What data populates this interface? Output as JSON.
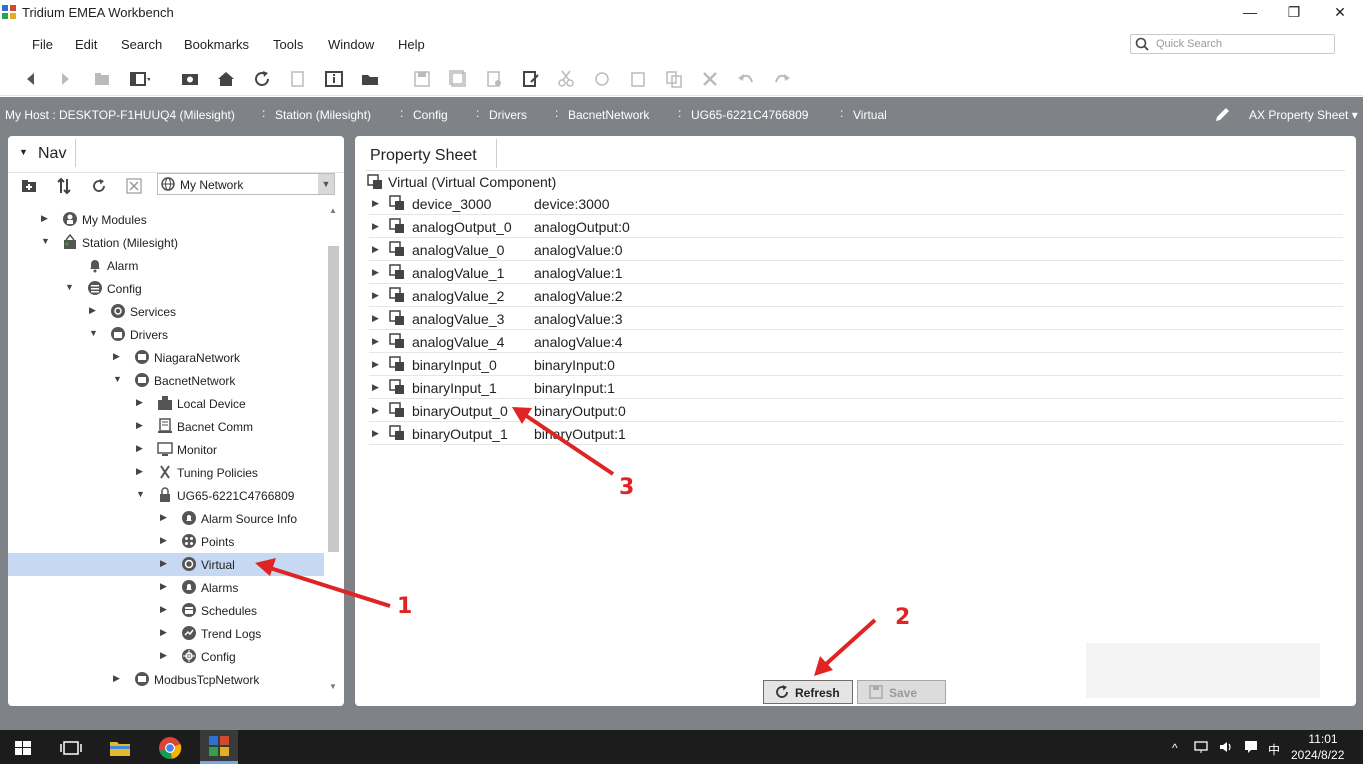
{
  "window": {
    "title": "Tridium EMEA Workbench",
    "minimize": "—",
    "restore": "❐",
    "close": "✕"
  },
  "menu": [
    "File",
    "Edit",
    "Search",
    "Bookmarks",
    "Tools",
    "Window",
    "Help"
  ],
  "quick_search": {
    "placeholder": "Quick Search"
  },
  "path": {
    "host": "My Host : DESKTOP-F1HUUQ4 (Milesight)",
    "crumbs": [
      "Station (Milesight)",
      "Config",
      "Drivers",
      "BacnetNetwork",
      "UG65-6221C4766809",
      "Virtual"
    ],
    "view_selector": "AX Property Sheet ▾"
  },
  "nav": {
    "tab_label": "Nav",
    "network_select": "My Network",
    "tree": [
      {
        "label": "My Modules",
        "expander": "▶",
        "icon": "modules-icon"
      },
      {
        "label": "Station (Milesight)",
        "expander": "▼",
        "icon": "station-icon"
      },
      {
        "label": "Alarm",
        "expander": "",
        "icon": "bell-icon"
      },
      {
        "label": "Config",
        "expander": "▼",
        "icon": "config-icon"
      },
      {
        "label": "Services",
        "expander": "▶",
        "icon": "services-icon"
      },
      {
        "label": "Drivers",
        "expander": "▼",
        "icon": "drivers-icon"
      },
      {
        "label": "NiagaraNetwork",
        "expander": "▶",
        "icon": "network-icon"
      },
      {
        "label": "BacnetNetwork",
        "expander": "▼",
        "icon": "network-icon"
      },
      {
        "label": "Local Device",
        "expander": "▶",
        "icon": "local-device-icon"
      },
      {
        "label": "Bacnet Comm",
        "expander": "▶",
        "icon": "comm-icon"
      },
      {
        "label": "Monitor",
        "expander": "▶",
        "icon": "monitor-icon"
      },
      {
        "label": "Tuning Policies",
        "expander": "▶",
        "icon": "tuning-icon"
      },
      {
        "label": "UG65-6221C4766809",
        "expander": "▼",
        "icon": "device-icon"
      },
      {
        "label": "Alarm Source Info",
        "expander": "▶",
        "icon": "alarm-source-icon"
      },
      {
        "label": "Points",
        "expander": "▶",
        "icon": "points-icon"
      },
      {
        "label": "Virtual",
        "expander": "▶",
        "icon": "virtual-icon",
        "selected": true
      },
      {
        "label": "Alarms",
        "expander": "▶",
        "icon": "alarms-icon"
      },
      {
        "label": "Schedules",
        "expander": "▶",
        "icon": "schedules-icon"
      },
      {
        "label": "Trend Logs",
        "expander": "▶",
        "icon": "trend-icon"
      },
      {
        "label": "Config",
        "expander": "▶",
        "icon": "config-icon"
      },
      {
        "label": "ModbusTcpNetwork",
        "expander": "▶",
        "icon": "network-icon"
      }
    ]
  },
  "property_sheet": {
    "tab_label": "Property Sheet",
    "header": "Virtual  (Virtual Component)",
    "rows": [
      {
        "name": "device_3000",
        "value": "device:3000"
      },
      {
        "name": "analogOutput_0",
        "value": "analogOutput:0"
      },
      {
        "name": "analogValue_0",
        "value": "analogValue:0"
      },
      {
        "name": "analogValue_1",
        "value": "analogValue:1"
      },
      {
        "name": "analogValue_2",
        "value": "analogValue:2"
      },
      {
        "name": "analogValue_3",
        "value": "analogValue:3"
      },
      {
        "name": "analogValue_4",
        "value": "analogValue:4"
      },
      {
        "name": "binaryInput_0",
        "value": "binaryInput:0"
      },
      {
        "name": "binaryInput_1",
        "value": "binaryInput:1"
      },
      {
        "name": "binaryOutput_0",
        "value": "binaryOutput:0"
      },
      {
        "name": "binaryOutput_1",
        "value": "binaryOutput:1"
      }
    ],
    "refresh_label": "Refresh",
    "save_label": "Save"
  },
  "annotations": [
    "1",
    "2",
    "3"
  ],
  "annotation_color": "#e02424",
  "taskbar": {
    "tray_ime": "中",
    "time": "11:01",
    "date": "2024/8/22"
  }
}
